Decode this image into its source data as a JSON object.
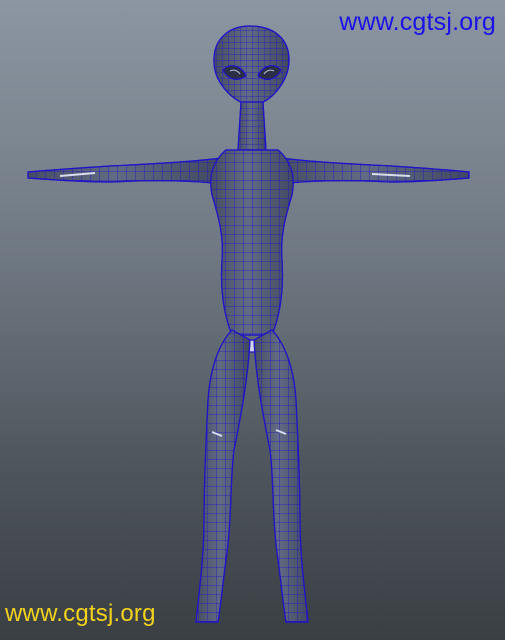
{
  "watermarks": {
    "top": "www.cgtsj.org",
    "bottom": "www.cgtsj.org"
  },
  "colors": {
    "wire": "#2014c8",
    "mesh_fill": "#535b71",
    "mesh_light": "#7e86a0",
    "watermark_top": "#1a12e6",
    "watermark_bottom": "#f2d21a"
  },
  "model": {
    "icon": "alien-wireframe-mesh"
  }
}
